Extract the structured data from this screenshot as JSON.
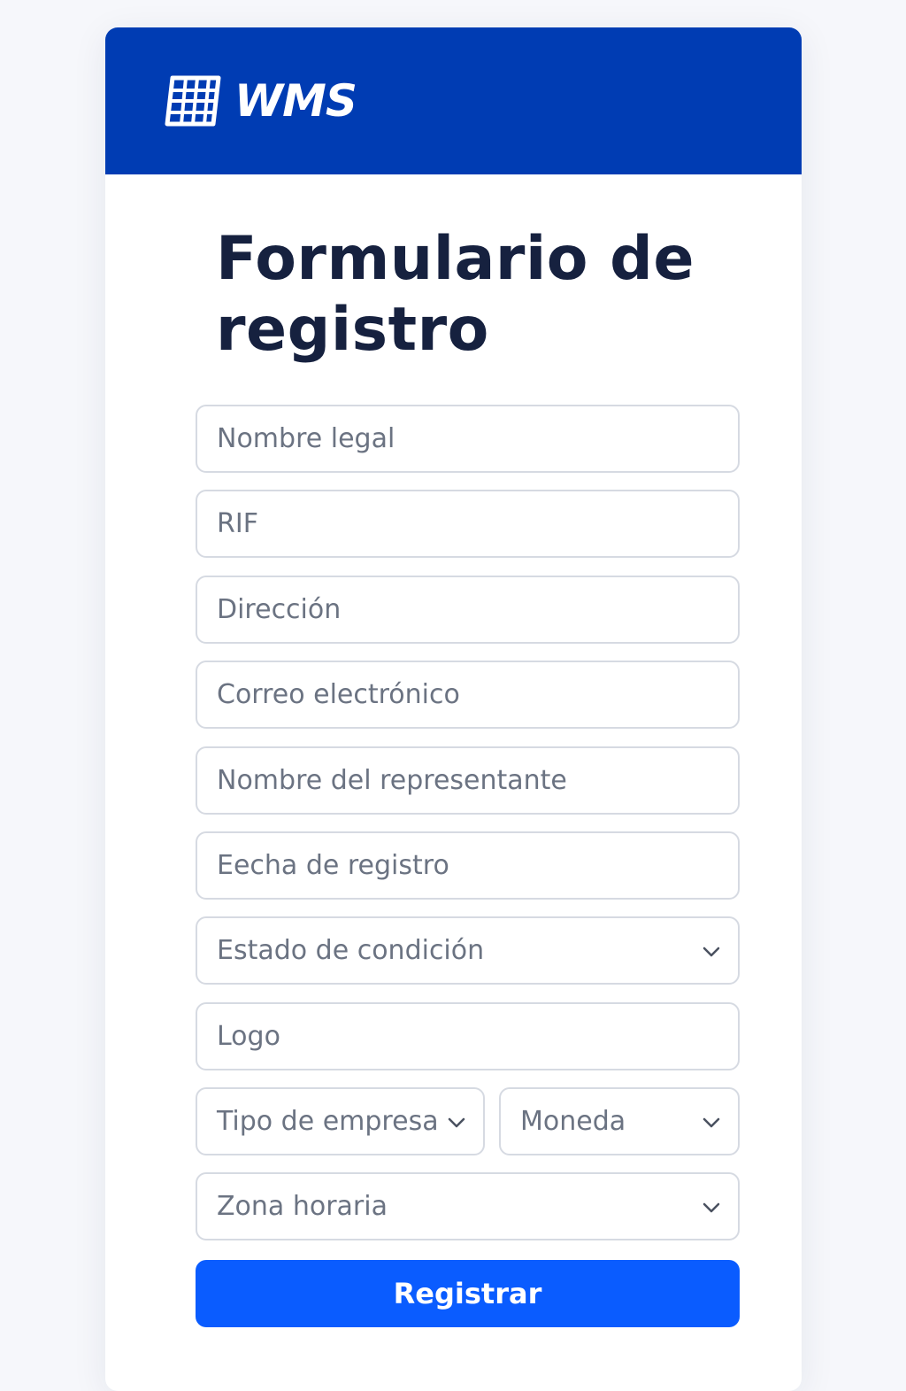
{
  "brand": {
    "name": "WMS",
    "icon": "grid-logo-icon",
    "header_color": "#003cb3"
  },
  "form": {
    "title": "Formulario de registro",
    "fields": {
      "legal_name": {
        "placeholder": "Nombre legal",
        "value": ""
      },
      "rif": {
        "placeholder": "RIF",
        "value": ""
      },
      "address": {
        "placeholder": "Dirección",
        "value": ""
      },
      "email": {
        "placeholder": "Correo electrónico",
        "value": ""
      },
      "representative": {
        "placeholder": "Nombre del representante",
        "value": ""
      },
      "registration_date": {
        "placeholder": "Eecha de registro",
        "value": ""
      },
      "logo": {
        "placeholder": "Logo",
        "value": ""
      }
    },
    "selects": {
      "condition_state": {
        "label": "Estado de condición",
        "icon": "chevron-down-icon"
      },
      "company_type": {
        "label": "Tipo de empresa",
        "icon": "chevron-down-icon"
      },
      "currency": {
        "label": "Moneda",
        "icon": "chevron-down-icon"
      },
      "timezone": {
        "label": "Zona horaria",
        "icon": "chevron-down-icon"
      }
    },
    "submit_label": "Registrar",
    "button_color": "#0a5cff"
  }
}
